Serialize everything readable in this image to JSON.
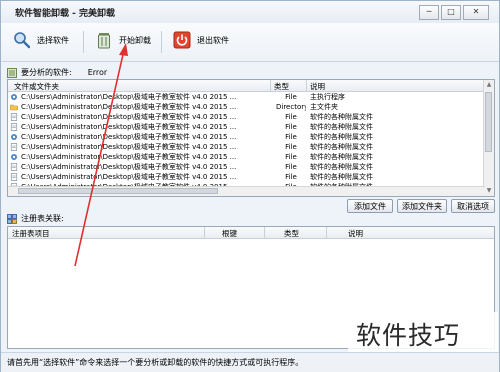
{
  "window": {
    "title": "软件智能卸载 - 完美卸载",
    "minimize": "─",
    "maximize": "□",
    "close": "✕"
  },
  "toolbar": {
    "select_software": "选择软件",
    "start_uninstall": "开始卸载",
    "exit_software": "退出软件"
  },
  "analysis": {
    "label": "要分析的软件:",
    "value": "Error"
  },
  "files_table": {
    "headers": [
      "文件或文件夹",
      "类型",
      "说明"
    ],
    "rows": [
      {
        "path": "C:\\Users\\Administrator\\Desktop\\极域电子教室软件 v4.0 2015 ...",
        "type": "File",
        "desc": "主执行程序",
        "icon": "gear-icon"
      },
      {
        "path": "C:\\Users\\Administrator\\Desktop\\极域电子教室软件 v4.0 2015 ...",
        "type": "Directory",
        "desc": "主文件夹",
        "icon": "folder-icon"
      },
      {
        "path": "C:\\Users\\Administrator\\Desktop\\极域电子教室软件 v4.0 2015 ...",
        "type": "File",
        "desc": "软件的各种附属文件",
        "icon": "file-icon"
      },
      {
        "path": "C:\\Users\\Administrator\\Desktop\\极域电子教室软件 v4.0 2015 ...",
        "type": "File",
        "desc": "软件的各种附属文件",
        "icon": "file-icon"
      },
      {
        "path": "C:\\Users\\Administrator\\Desktop\\极域电子教室软件 v4.0 2015 ...",
        "type": "File",
        "desc": "软件的各种附属文件",
        "icon": "gear-icon"
      },
      {
        "path": "C:\\Users\\Administrator\\Desktop\\极域电子教室软件 v4.0 2015 ...",
        "type": "File",
        "desc": "软件的各种附属文件",
        "icon": "file-icon"
      },
      {
        "path": "C:\\Users\\Administrator\\Desktop\\极域电子教室软件 v4.0 2015 ...",
        "type": "File",
        "desc": "软件的各种附属文件",
        "icon": "gear-icon"
      },
      {
        "path": "C:\\Users\\Administrator\\Desktop\\极域电子教室软件 v4.0 2015 ...",
        "type": "File",
        "desc": "软件的各种附属文件",
        "icon": "file-icon"
      },
      {
        "path": "C:\\Users\\Administrator\\Desktop\\极域电子教室软件 v4.0 2015 ...",
        "type": "File",
        "desc": "软件的各种附属文件",
        "icon": "file-icon"
      },
      {
        "path": "C:\\Users\\Administrator\\Desktop\\极域电子教室软件 v4.0 2015 ...",
        "type": "File",
        "desc": "软件的各种附属文件",
        "icon": "file-icon"
      }
    ]
  },
  "file_buttons": {
    "add_file": "添加文件",
    "add_folder": "添加文件夹",
    "cancel_selection": "取消选项"
  },
  "registry": {
    "label": "注册表关联:",
    "headers": [
      "注册表项目",
      "根键",
      "类型",
      "说明"
    ]
  },
  "status": {
    "text": "请首先用“选择软件”命令来选择一个要分析或卸载的软件的快捷方式或可执行程序。"
  },
  "watermark": {
    "text": "软件技巧"
  },
  "colors": {
    "annotation_arrow": "#e03030"
  }
}
